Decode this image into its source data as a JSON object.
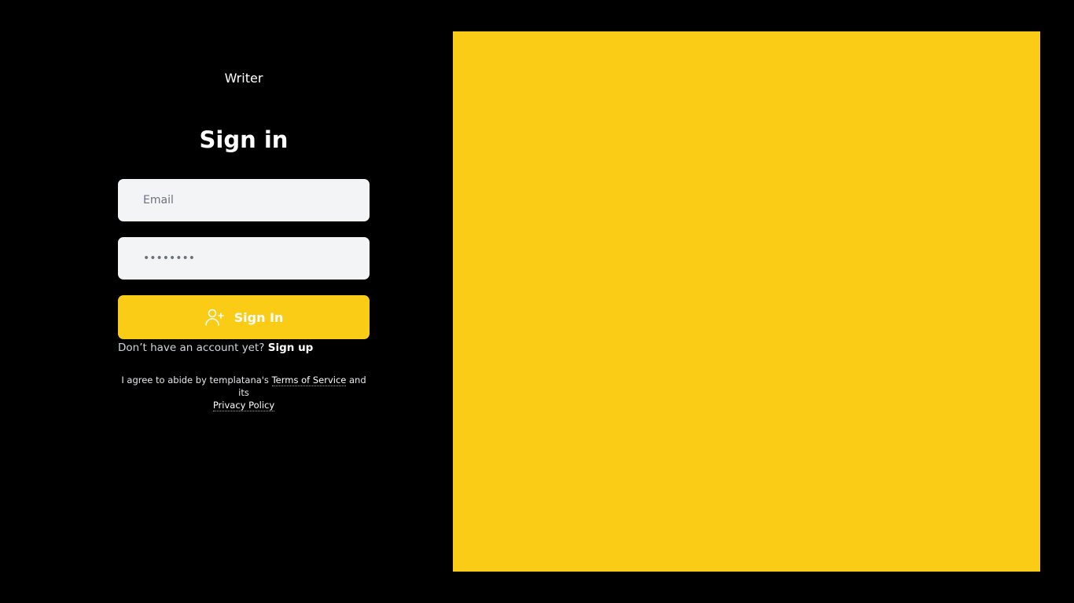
{
  "brand": {
    "name": "Writer"
  },
  "form": {
    "title": "Sign in",
    "email": {
      "placeholder": "Email",
      "value": ""
    },
    "password": {
      "placeholder": "••••••••",
      "value": ""
    },
    "submit_label": "Sign In",
    "submit_icon": "user-plus-icon"
  },
  "signup": {
    "prompt": "Don’t have an account yet? ",
    "link_label": "Sign up"
  },
  "terms": {
    "prefix": "I agree to abide by templatana's ",
    "tos_label": "Terms of Service",
    "middle": " and its ",
    "privacy_label": "Privacy Policy"
  },
  "colors": {
    "background": "#000000",
    "accent": "#facc15",
    "input_bg": "#f3f4f6"
  }
}
